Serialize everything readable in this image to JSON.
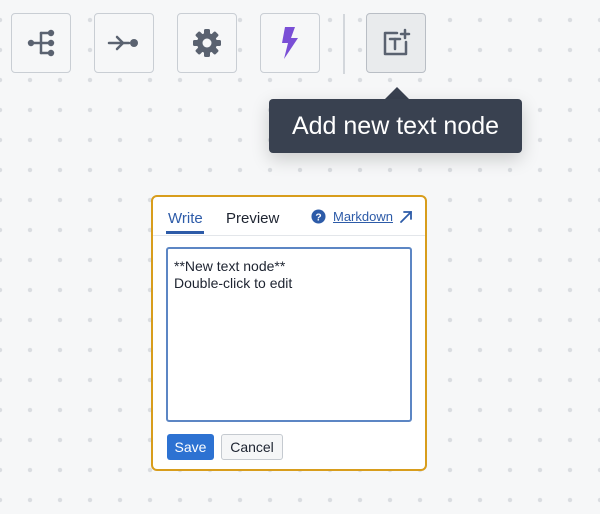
{
  "toolbar": {
    "buttons": [
      {
        "icon": "graph-tree-icon"
      },
      {
        "icon": "flow-arrow-icon"
      },
      {
        "icon": "gear-icon"
      },
      {
        "icon": "lightning-icon",
        "color": "#7a4fd6"
      },
      {
        "icon": "add-text-node-icon",
        "state": "hovered"
      }
    ],
    "tooltip": "Add new text node"
  },
  "editor": {
    "tabs": {
      "write": "Write",
      "preview": "Preview",
      "active": "Write"
    },
    "help_icon": "question-circle-icon",
    "markdown_link": "Markdown",
    "external_icon": "arrow-up-right-icon",
    "text_lines": [
      "**New text node**",
      "",
      "Double-click to edit"
    ],
    "save_label": "Save",
    "cancel_label": "Cancel",
    "border_color": "#d89d1c",
    "accent_color": "#2d72d2"
  }
}
